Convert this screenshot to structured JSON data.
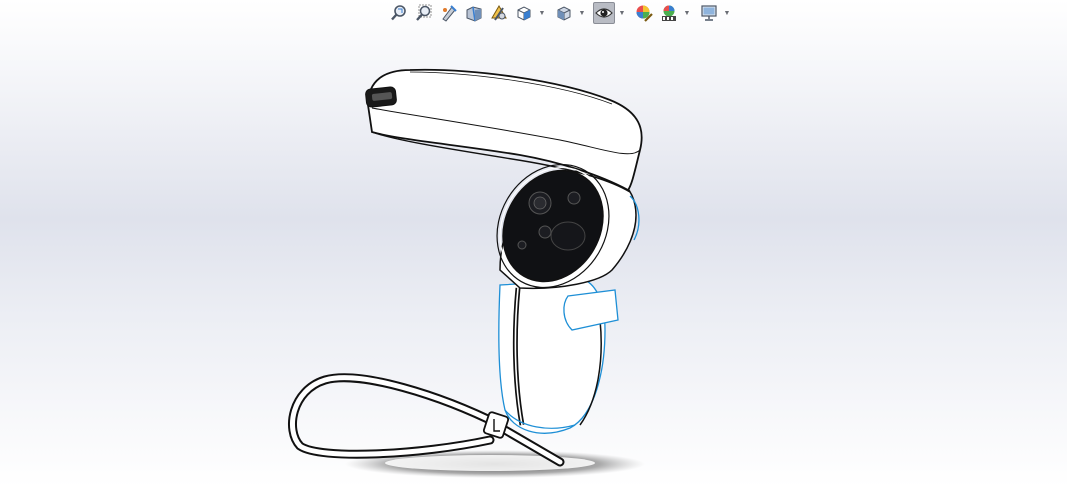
{
  "view": {
    "background_top": "#ffffff",
    "background_mid": "#dfe2ec",
    "accent_edge_color": "#1e8fd6",
    "model_body_color": "#ffffff",
    "model_face_color": "#101114"
  },
  "heads_up_toolbar": {
    "buttons": [
      {
        "id": "zoom-to-fit",
        "icon": "zoom-to-fit-icon"
      },
      {
        "id": "zoom-to-area",
        "icon": "zoom-to-area-icon"
      },
      {
        "id": "previous-view",
        "icon": "previous-view-icon"
      },
      {
        "id": "section-view",
        "icon": "section-view-icon"
      },
      {
        "id": "dynamic-annotation-views",
        "icon": "dynamic-annotation-icon"
      },
      {
        "id": "view-orientation",
        "icon": "view-orientation-icon",
        "has_dropdown": true
      },
      {
        "id": "display-style",
        "icon": "display-style-icon",
        "has_dropdown": true
      },
      {
        "id": "hide-show-items",
        "icon": "hide-show-eye-icon",
        "has_dropdown": true,
        "active": true
      },
      {
        "id": "edit-appearance",
        "icon": "edit-appearance-icon"
      },
      {
        "id": "apply-scene",
        "icon": "apply-scene-icon",
        "has_dropdown": true
      },
      {
        "id": "view-settings",
        "icon": "view-settings-monitor-icon",
        "has_dropdown": true
      }
    ]
  }
}
